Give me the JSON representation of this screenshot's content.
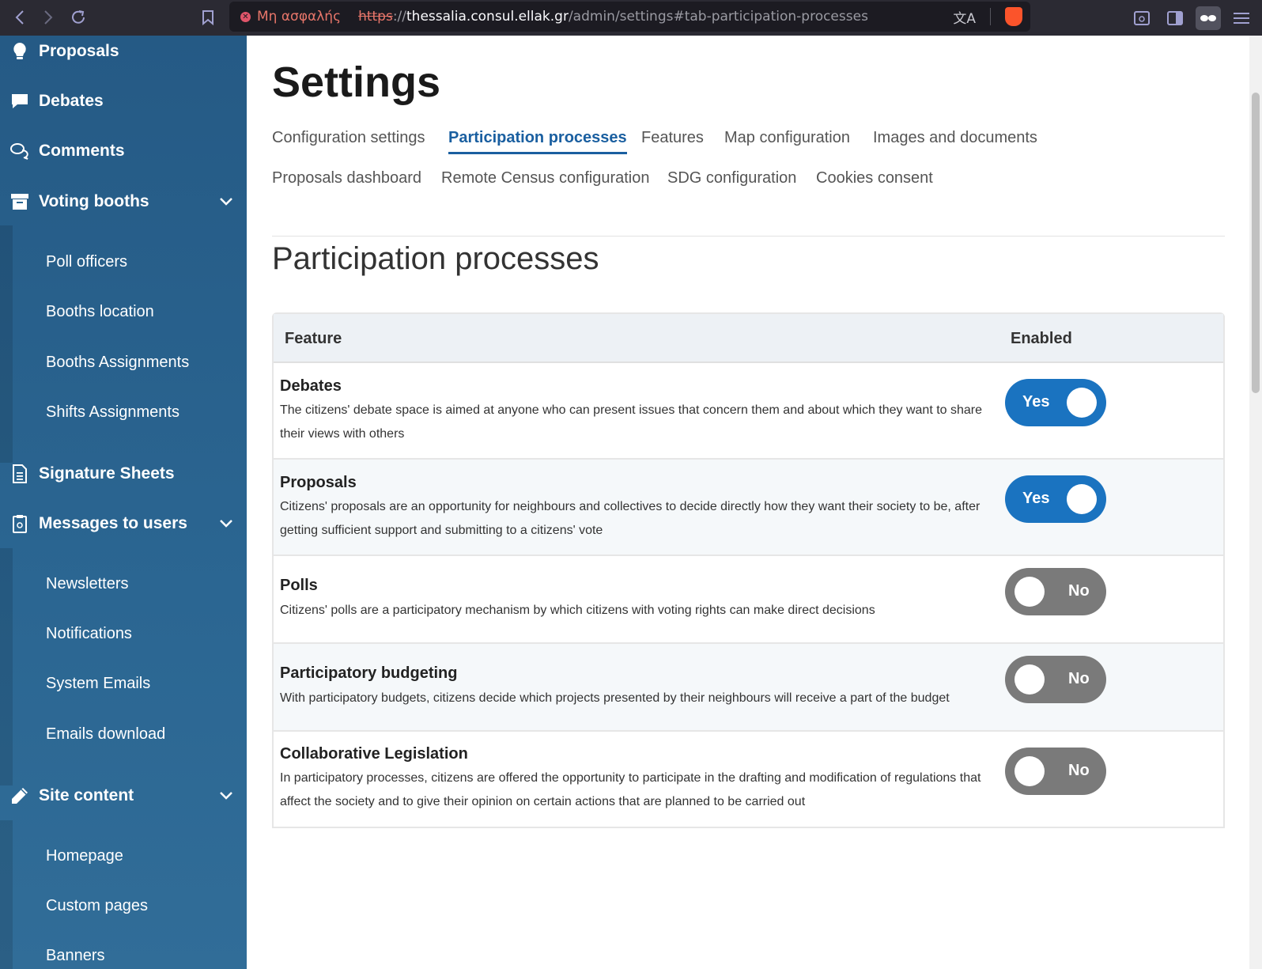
{
  "browser": {
    "insecure_label": "Μη ασφαλής",
    "url_scheme": "https",
    "url_sep": "://",
    "url_host": "thessalia.consul.ellak.gr",
    "url_path": "/admin/settings#tab-participation-processes",
    "icons": [
      "back-icon",
      "forward-icon",
      "reload-icon",
      "bookmark-icon",
      "translate-icon",
      "brave-shield-icon",
      "reader-icon",
      "sidebar-icon",
      "private-icon",
      "menu-icon"
    ]
  },
  "sidebar": {
    "items": [
      {
        "label": "Proposals",
        "icon": "lightbulb-icon"
      },
      {
        "label": "Debates",
        "icon": "speech-bubble-icon"
      },
      {
        "label": "Comments",
        "icon": "comments-icon"
      },
      {
        "label": "Voting booths",
        "icon": "archive-box-icon"
      },
      {
        "label": "Poll officers"
      },
      {
        "label": "Booths location"
      },
      {
        "label": "Booths Assignments"
      },
      {
        "label": "Shifts Assignments"
      },
      {
        "label": "Signature Sheets",
        "icon": "document-icon"
      },
      {
        "label": "Messages to users",
        "icon": "clipboard-icon"
      },
      {
        "label": "Newsletters"
      },
      {
        "label": "Notifications"
      },
      {
        "label": "System Emails"
      },
      {
        "label": "Emails download"
      },
      {
        "label": "Site content",
        "icon": "pencil-icon"
      },
      {
        "label": "Homepage"
      },
      {
        "label": "Custom pages"
      },
      {
        "label": "Banners"
      }
    ]
  },
  "main": {
    "title": "Settings",
    "tabs": [
      "Configuration settings",
      "Participation processes",
      "Features",
      "Map configuration",
      "Images and documents",
      "Proposals dashboard",
      "Remote Census configuration",
      "SDG configuration",
      "Cookies consent"
    ],
    "active_tab": "Participation processes",
    "section_title": "Participation processes",
    "table": {
      "headers": [
        "Feature",
        "Enabled"
      ],
      "rows": [
        {
          "name": "Debates",
          "desc": "The citizens' debate space is aimed at anyone who can present issues that concern them and about which they want to share their views with others",
          "state": "Yes"
        },
        {
          "name": "Proposals",
          "desc": "Citizens' proposals are an opportunity for neighbours and collectives to decide directly how they want their society to be, after getting sufficient support and submitting to a citizens' vote",
          "state": "Yes"
        },
        {
          "name": "Polls",
          "desc": "Citizens' polls are a participatory mechanism by which citizens with voting rights can make direct decisions",
          "state": "No"
        },
        {
          "name": "Participatory budgeting",
          "desc": "With participatory budgets, citizens decide which projects presented by their neighbours will receive a part of the budget",
          "state": "No"
        },
        {
          "name": "Collaborative Legislation",
          "desc": "In participatory processes, citizens are offered the opportunity to participate in the drafting and modification of regulations that affect the society and to give their opinion on certain actions that are planned to be carried out",
          "state": "No"
        }
      ]
    }
  },
  "colors": {
    "sidebar_bg": "#2b6692",
    "active_tab": "#1a5fa0",
    "toggle_on": "#1a73c0",
    "toggle_off": "#7a7a7a",
    "table_header_bg": "#edf1f5"
  }
}
